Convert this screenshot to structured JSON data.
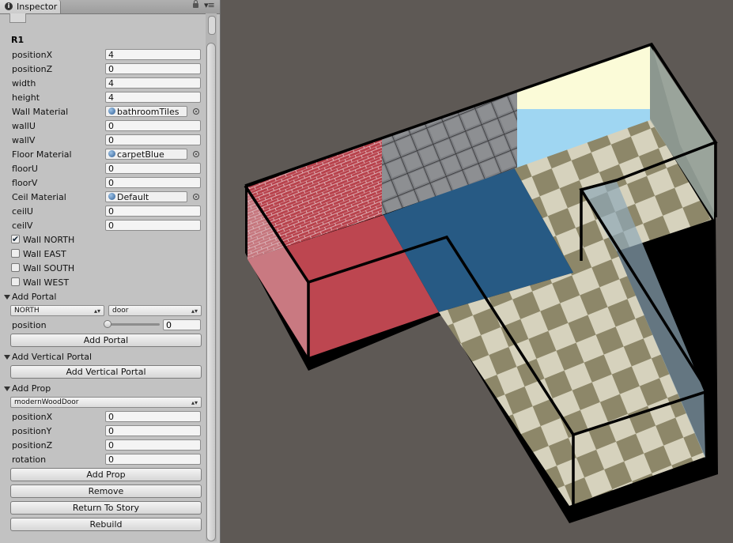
{
  "tab": {
    "title": "Inspector",
    "icon": "info-icon"
  },
  "object": {
    "name": "R1"
  },
  "fields": {
    "positionX": {
      "label": "positionX",
      "value": "4"
    },
    "positionZ": {
      "label": "positionZ",
      "value": "0"
    },
    "width": {
      "label": "width",
      "value": "4"
    },
    "height": {
      "label": "height",
      "value": "4"
    },
    "wallMaterial": {
      "label": "Wall Material",
      "value": "bathroomTiles"
    },
    "wallU": {
      "label": "wallU",
      "value": "0"
    },
    "wallV": {
      "label": "wallV",
      "value": "0"
    },
    "floorMaterial": {
      "label": "Floor Material",
      "value": "carpetBlue"
    },
    "floorU": {
      "label": "floorU",
      "value": "0"
    },
    "floorV": {
      "label": "floorV",
      "value": "0"
    },
    "ceilMaterial": {
      "label": "Ceil Material",
      "value": "Default"
    },
    "ceilU": {
      "label": "ceilU",
      "value": "0"
    },
    "ceilV": {
      "label": "ceilV",
      "value": "0"
    }
  },
  "walls": {
    "north": {
      "label": "Wall NORTH",
      "checked": true,
      "mark": "✔"
    },
    "east": {
      "label": "Wall EAST",
      "checked": false
    },
    "south": {
      "label": "Wall SOUTH",
      "checked": false
    },
    "west": {
      "label": "Wall WEST",
      "checked": false
    }
  },
  "addPortal": {
    "header": "Add Portal",
    "direction": "NORTH",
    "type": "door",
    "position_label": "position",
    "position_value": "0",
    "position_slider_fraction": 0,
    "button": "Add Portal"
  },
  "addVerticalPortal": {
    "header": "Add Vertical Portal",
    "button": "Add Vertical Portal"
  },
  "addProp": {
    "header": "Add Prop",
    "prop": "modernWoodDoor",
    "positionX": {
      "label": "positionX",
      "value": "0"
    },
    "positionY": {
      "label": "positionY",
      "value": "0"
    },
    "positionZ": {
      "label": "positionZ",
      "value": "0"
    },
    "rotation": {
      "label": "rotation",
      "value": "0"
    },
    "button": "Add Prop"
  },
  "actions": {
    "remove": "Remove",
    "returnToStory": "Return To Story",
    "rebuild": "Rebuild"
  },
  "colors": {
    "panel": "#c2c2c2",
    "viewport": "#5e5955",
    "brick": "#b8424c",
    "tiles": "#7c7e82",
    "wallLight": "#fbfbd8",
    "wallBlue": "#9fd6f2",
    "redFloor": "#bd4650",
    "blueFloor": "#275a84",
    "checkerLight": "#d6d2bd",
    "checkerDark": "#8d8769",
    "glassWall": "#a5b1a8",
    "outline": "#000000"
  }
}
